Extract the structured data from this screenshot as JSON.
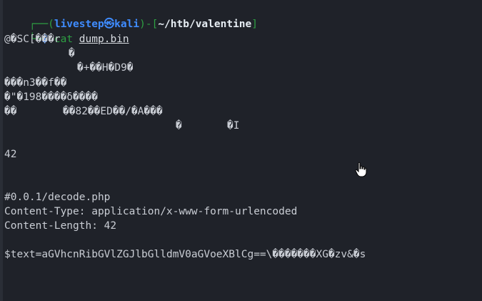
{
  "prompt": {
    "line1_prefix": "┌──(",
    "user_host": "livestep㉿kali",
    "mid": ")-[",
    "path": "~/htb/valentine",
    "suffix": "]",
    "line2_prefix": "└─",
    "dollar": "$",
    "command": "cat",
    "argument": "dump.bin"
  },
  "output": {
    "line1": "@�SC[���r",
    "line2": "�",
    "line3": "�+��H�D9�",
    "line4": "���n3��f��",
    "line5": "�\"�198����δ����",
    "line6": "��",
    "line6b": "��82��ED��/�A���",
    "line7a": "�",
    "line7b": "�I",
    "line8": "42",
    "line9": "#0.0.1/decode.php",
    "line10": "Content-Type: application/x-www-form-urlencoded",
    "line11": "Content-Length: 42",
    "line12": "$text=aGVhcnRibGVlZGJlbGlldmV0aGVoeXBlCg==\\�������XG�zv&�s"
  },
  "colors": {
    "background": "#1f2229",
    "prompt_bracket": "#2ea043",
    "prompt_user": "#3f8cff",
    "command": "#2ea043",
    "text": "#c9cdd4"
  },
  "icons": {
    "cursor": "hand-pointer-icon"
  }
}
